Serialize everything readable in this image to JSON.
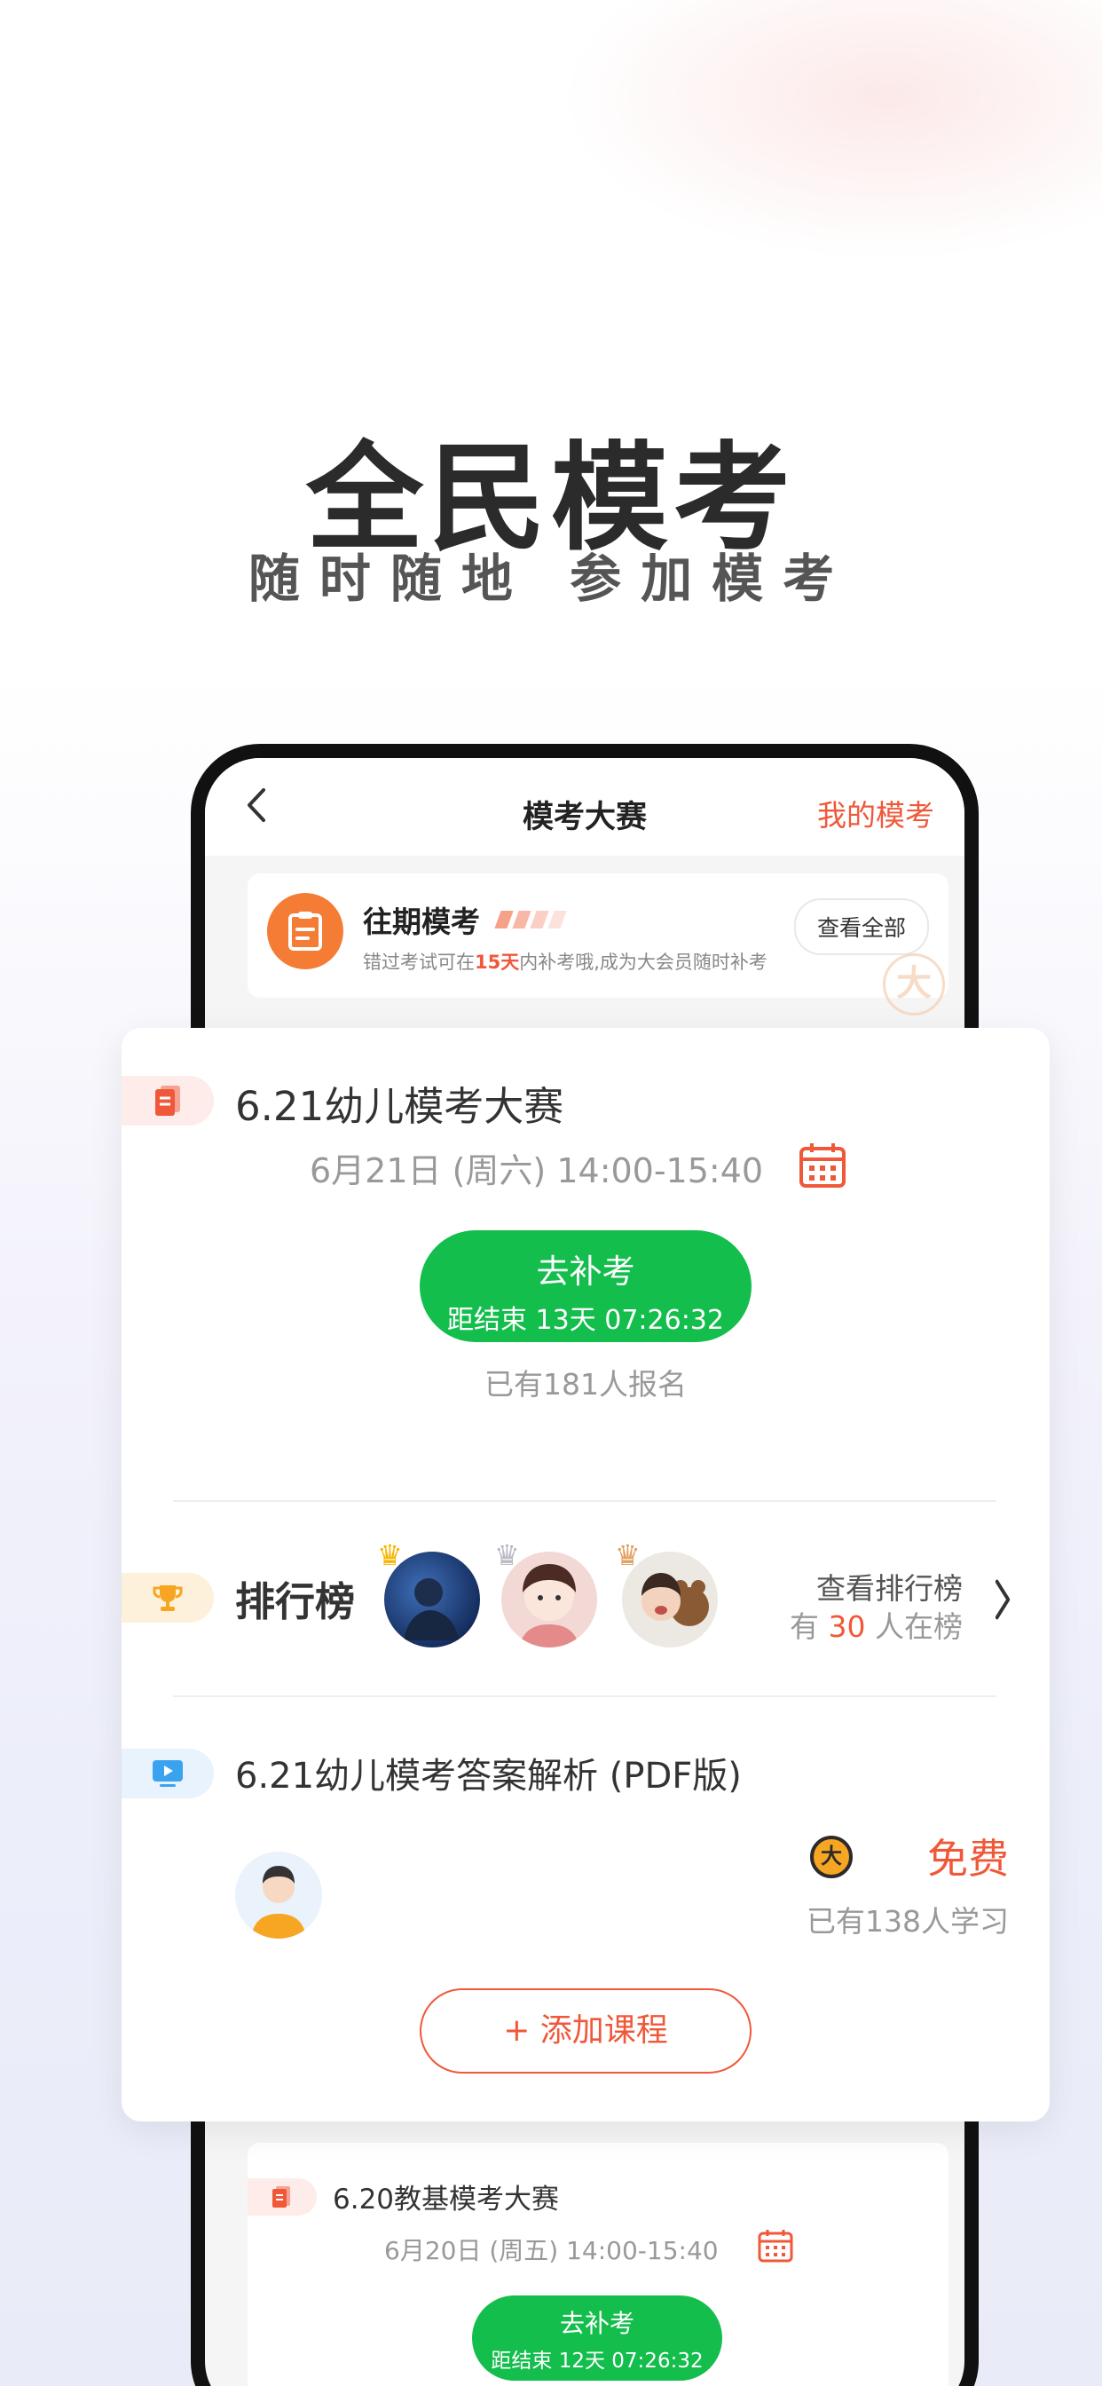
{
  "promo": {
    "headline": "全民模考",
    "subline": "随时随地 参加模考"
  },
  "nav": {
    "back_icon": "chevron-left-icon",
    "title": "模考大赛",
    "my_exams": "我的模考"
  },
  "past_exams": {
    "title": "往期模考",
    "description_prefix": "错过考试可在",
    "description_highlight": "15天",
    "description_suffix": "内补考哦,成为大会员随时补考",
    "view_all": "查看全部"
  },
  "exam": {
    "title": "6.21幼儿模考大赛",
    "time": "6月21日 (周六) 14:00-15:40",
    "button_label": "去补考",
    "countdown": "距结束 13天  07:26:32",
    "signed_up": "已有181人报名"
  },
  "ranking": {
    "title": "排行榜",
    "view_label": "查看排行榜",
    "count_prefix": "有 ",
    "count": "30",
    "count_suffix": " 人在榜"
  },
  "course": {
    "title": "6.21幼儿模考答案解析 (PDF版)",
    "price": "免费",
    "learned": "已有138人学习",
    "add_button": "+ 添加课程"
  },
  "next_exam": {
    "title": "6.20教基模考大赛",
    "time": "6月20日 (周五) 14:00-15:40",
    "button_label": "去补考",
    "countdown": "距结束 12天  07:26:32"
  },
  "colors": {
    "accent": "#f0583a",
    "green": "#13be4c",
    "orange_icon": "#f47c35"
  }
}
